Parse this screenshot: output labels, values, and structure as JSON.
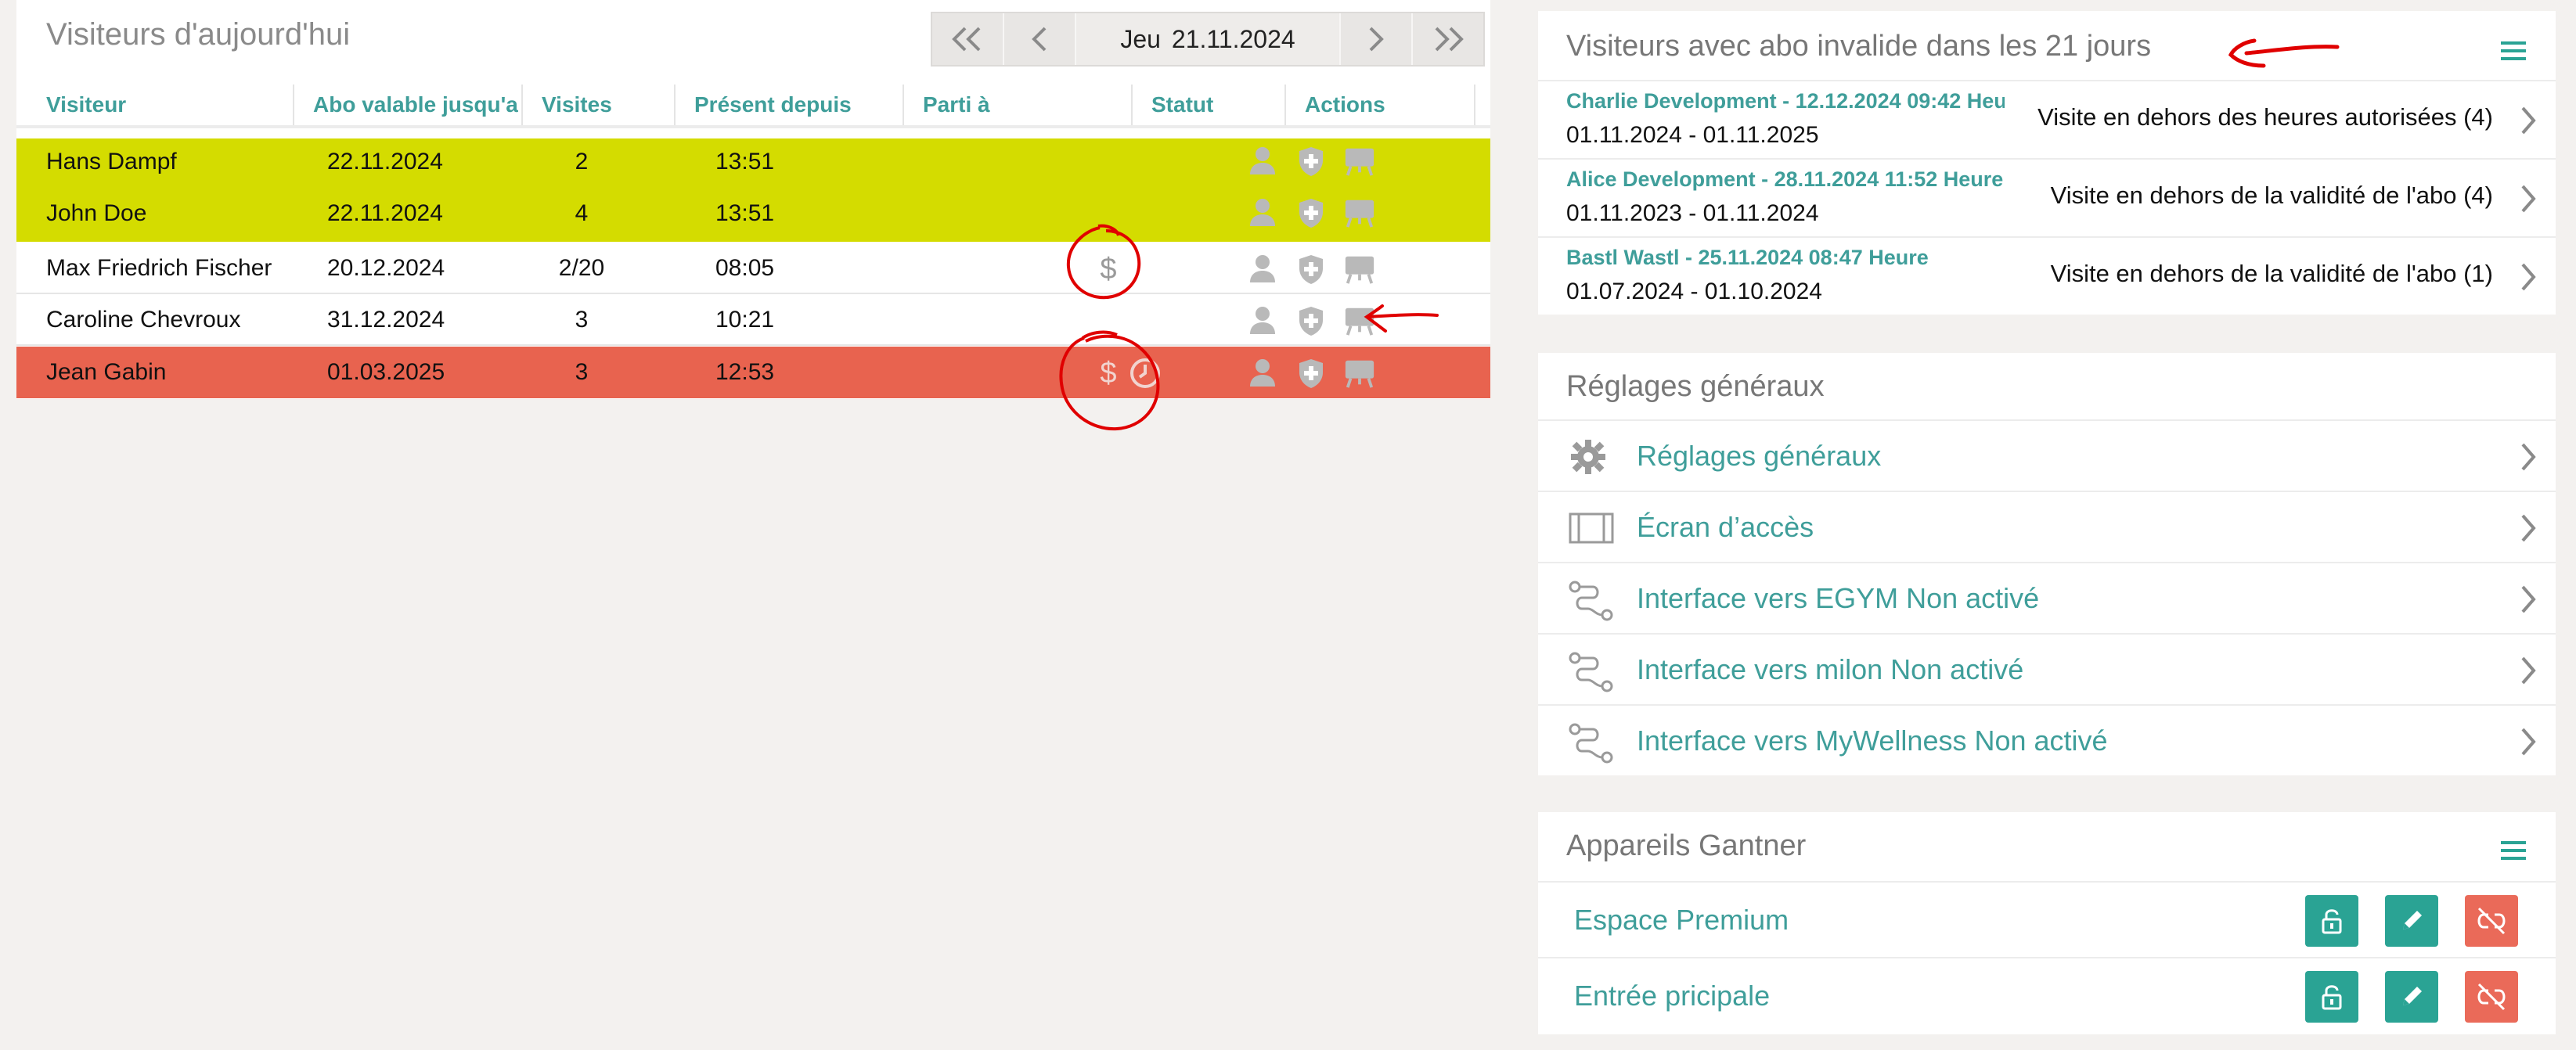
{
  "today": {
    "title": "Visiteurs d'aujourd'hui",
    "date_day": "Jeu",
    "date_value": "21.11.2024",
    "columns": [
      "Visiteur",
      "Abo valable jusqu'a",
      "Visites",
      "Présent depuis",
      "Parti à",
      "Statut",
      "Actions"
    ],
    "rows": [
      {
        "name": "Hans Dampf",
        "abo": "22.11.2024",
        "visits": "2",
        "since": "13:51",
        "left": "",
        "status": "yellow"
      },
      {
        "name": "John Doe",
        "abo": "22.11.2024",
        "visits": "4",
        "since": "13:51",
        "left": "",
        "status": "yellow"
      },
      {
        "name": "Max Friedrich Fischer",
        "abo": "20.12.2024",
        "visits": "2/20",
        "since": "08:05",
        "left": "",
        "status": "white"
      },
      {
        "name": "Caroline Chevroux",
        "abo": "31.12.2024",
        "visits": "3",
        "since": "10:21",
        "left": "",
        "status": "white"
      },
      {
        "name": "Jean Gabin",
        "abo": "01.03.2025",
        "visits": "3",
        "since": "12:53",
        "left": "",
        "status": "red"
      }
    ]
  },
  "invalid": {
    "title": "Visiteurs avec abo invalide dans les 21 jours",
    "items": [
      {
        "who": "Charlie Development - 12.12.2024 09:42 Heure",
        "range": "01.11.2024 - 01.11.2025",
        "reason": "Visite en dehors des heures autorisées (4)"
      },
      {
        "who": "Alice Development - 28.11.2024 11:52 Heure",
        "range": "01.11.2023 - 01.11.2024",
        "reason": "Visite en dehors de la validité de l'abo (4)"
      },
      {
        "who": "Bastl Wastl - 25.11.2024 08:47 Heure",
        "range": "01.07.2024 - 01.10.2024",
        "reason": "Visite en dehors de la validité de l'abo (1)"
      }
    ]
  },
  "settings": {
    "title": "Réglages généraux",
    "items": [
      {
        "label": "Réglages généraux",
        "icon": "gear-icon"
      },
      {
        "label": "Écran d’accès",
        "icon": "screen-icon"
      },
      {
        "label": "Interface vers EGYM Non activé",
        "icon": "route-icon"
      },
      {
        "label": "Interface vers milon Non activé",
        "icon": "route-icon"
      },
      {
        "label": "Interface vers MyWellness Non activé",
        "icon": "route-icon"
      }
    ]
  },
  "devices": {
    "title": "Appareils Gantner",
    "items": [
      {
        "label": "Espace Premium"
      },
      {
        "label": "Entrée pricipale"
      }
    ]
  },
  "colors": {
    "accent": "#3f9e9a",
    "row_yellow": "#d4dc00",
    "row_red": "#e8634f",
    "button_teal": "#2aa394",
    "button_red": "#ea6a59",
    "annotation_red": "#e00000"
  }
}
